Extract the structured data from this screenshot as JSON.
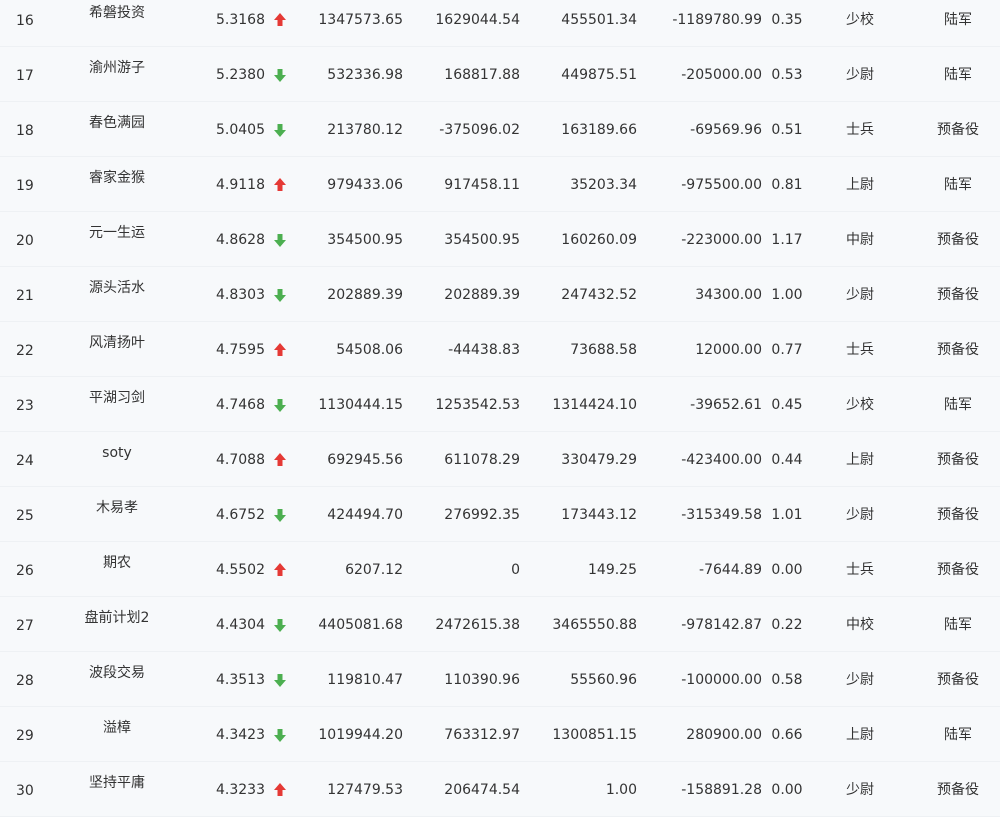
{
  "colors": {
    "up": "#e53935",
    "down": "#4caf50",
    "text": "#333333",
    "background": "#f7f9fb"
  },
  "rows": [
    {
      "rank": "16",
      "name": "希磐投资",
      "score": "5.3168",
      "trend": "up",
      "v1": "1347573.65",
      "v2": "1629044.54",
      "v3": "455501.34",
      "v4": "-1189780.99",
      "ratio": "0.35",
      "grade": "少校",
      "branch": "陆军"
    },
    {
      "rank": "17",
      "name": "渝州游子",
      "score": "5.2380",
      "trend": "down",
      "v1": "532336.98",
      "v2": "168817.88",
      "v3": "449875.51",
      "v4": "-205000.00",
      "ratio": "0.53",
      "grade": "少尉",
      "branch": "陆军"
    },
    {
      "rank": "18",
      "name": "春色满园",
      "score": "5.0405",
      "trend": "down",
      "v1": "213780.12",
      "v2": "-375096.02",
      "v3": "163189.66",
      "v4": "-69569.96",
      "ratio": "0.51",
      "grade": "士兵",
      "branch": "预备役"
    },
    {
      "rank": "19",
      "name": "睿家金猴",
      "score": "4.9118",
      "trend": "up",
      "v1": "979433.06",
      "v2": "917458.11",
      "v3": "35203.34",
      "v4": "-975500.00",
      "ratio": "0.81",
      "grade": "上尉",
      "branch": "陆军"
    },
    {
      "rank": "20",
      "name": "元一生运",
      "score": "4.8628",
      "trend": "down",
      "v1": "354500.95",
      "v2": "354500.95",
      "v3": "160260.09",
      "v4": "-223000.00",
      "ratio": "1.17",
      "grade": "中尉",
      "branch": "预备役"
    },
    {
      "rank": "21",
      "name": "源头活水",
      "score": "4.8303",
      "trend": "down",
      "v1": "202889.39",
      "v2": "202889.39",
      "v3": "247432.52",
      "v4": "34300.00",
      "ratio": "1.00",
      "grade": "少尉",
      "branch": "预备役"
    },
    {
      "rank": "22",
      "name": "风清扬叶",
      "score": "4.7595",
      "trend": "up",
      "v1": "54508.06",
      "v2": "-44438.83",
      "v3": "73688.58",
      "v4": "12000.00",
      "ratio": "0.77",
      "grade": "士兵",
      "branch": "预备役"
    },
    {
      "rank": "23",
      "name": "平湖习剑",
      "score": "4.7468",
      "trend": "down",
      "v1": "1130444.15",
      "v2": "1253542.53",
      "v3": "1314424.10",
      "v4": "-39652.61",
      "ratio": "0.45",
      "grade": "少校",
      "branch": "陆军"
    },
    {
      "rank": "24",
      "name": "soty",
      "score": "4.7088",
      "trend": "up",
      "v1": "692945.56",
      "v2": "611078.29",
      "v3": "330479.29",
      "v4": "-423400.00",
      "ratio": "0.44",
      "grade": "上尉",
      "branch": "预备役"
    },
    {
      "rank": "25",
      "name": "木易孝",
      "score": "4.6752",
      "trend": "down",
      "v1": "424494.70",
      "v2": "276992.35",
      "v3": "173443.12",
      "v4": "-315349.58",
      "ratio": "1.01",
      "grade": "少尉",
      "branch": "预备役"
    },
    {
      "rank": "26",
      "name": "期农",
      "score": "4.5502",
      "trend": "up",
      "v1": "6207.12",
      "v2": "0",
      "v3": "149.25",
      "v4": "-7644.89",
      "ratio": "0.00",
      "grade": "士兵",
      "branch": "预备役"
    },
    {
      "rank": "27",
      "name": "盘前计划2",
      "score": "4.4304",
      "trend": "down",
      "v1": "4405081.68",
      "v2": "2472615.38",
      "v3": "3465550.88",
      "v4": "-978142.87",
      "ratio": "0.22",
      "grade": "中校",
      "branch": "陆军"
    },
    {
      "rank": "28",
      "name": "波段交易",
      "score": "4.3513",
      "trend": "down",
      "v1": "119810.47",
      "v2": "110390.96",
      "v3": "55560.96",
      "v4": "-100000.00",
      "ratio": "0.58",
      "grade": "少尉",
      "branch": "预备役"
    },
    {
      "rank": "29",
      "name": "溢樟",
      "score": "4.3423",
      "trend": "down",
      "v1": "1019944.20",
      "v2": "763312.97",
      "v3": "1300851.15",
      "v4": "280900.00",
      "ratio": "0.66",
      "grade": "上尉",
      "branch": "陆军"
    },
    {
      "rank": "30",
      "name": "坚持平庸",
      "score": "4.3233",
      "trend": "up",
      "v1": "127479.53",
      "v2": "206474.54",
      "v3": "1.00",
      "v4": "-158891.28",
      "ratio": "0.00",
      "grade": "少尉",
      "branch": "预备役"
    }
  ]
}
